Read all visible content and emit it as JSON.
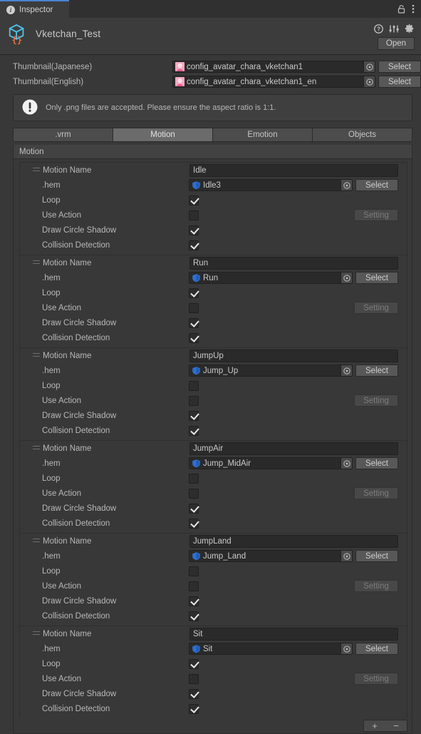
{
  "window": {
    "tab_label": "Inspector",
    "tab_icon": "info-icon",
    "lock_icon": "lock-icon",
    "menu_icon": "kebab-menu-icon"
  },
  "object_header": {
    "icon": "prefab-cube-braces-icon",
    "name": "Vketchan_Test",
    "help_icon": "help-icon",
    "preset_icon": "preset-sliders-icon",
    "settings_icon": "gear-icon",
    "open_label": "Open"
  },
  "thumbnails": [
    {
      "label": "Thumbnail(Japanese)",
      "value": "config_avatar_chara_vketchan1",
      "asset_icon": "texture-preview-icon",
      "picker_icon": "object-picker-icon",
      "select_label": "Select"
    },
    {
      "label": "Thumbnail(English)",
      "value": "config_avatar_chara_vketchan1_en",
      "asset_icon": "texture-preview-icon",
      "picker_icon": "object-picker-icon",
      "select_label": "Select"
    }
  ],
  "helpbox": {
    "icon": "warning-exclamation-icon",
    "text": "Only .png files are accepted. Please ensure the aspect ratio is 1:1."
  },
  "tabs": [
    {
      "label": ".vrm",
      "active": false
    },
    {
      "label": "Motion",
      "active": true
    },
    {
      "label": "Emotion",
      "active": false
    },
    {
      "label": "Objects",
      "active": false
    }
  ],
  "list": {
    "header": "Motion",
    "field_labels": {
      "motion_name": "Motion Name",
      "hem": ".hem",
      "loop": "Loop",
      "use_action": "Use Action",
      "draw_circle_shadow": "Draw Circle Shadow",
      "collision_detection": "Collision Detection"
    },
    "select_label": "Select",
    "setting_label": "Setting",
    "add_label": "+",
    "remove_label": "−",
    "items": [
      {
        "motion_name": "Idle",
        "hem": "Idle3",
        "loop": true,
        "use_action": false,
        "draw_circle_shadow": true,
        "collision_detection": true
      },
      {
        "motion_name": "Run",
        "hem": "Run",
        "loop": true,
        "use_action": false,
        "draw_circle_shadow": true,
        "collision_detection": true
      },
      {
        "motion_name": "JumpUp",
        "hem": "Jump_Up",
        "loop": false,
        "use_action": false,
        "draw_circle_shadow": true,
        "collision_detection": true
      },
      {
        "motion_name": "JumpAir",
        "hem": "Jump_MidAir",
        "loop": false,
        "use_action": false,
        "draw_circle_shadow": true,
        "collision_detection": true
      },
      {
        "motion_name": "JumpLand",
        "hem": "Jump_Land",
        "loop": false,
        "use_action": false,
        "draw_circle_shadow": true,
        "collision_detection": true
      },
      {
        "motion_name": "Sit",
        "hem": "Sit",
        "loop": true,
        "use_action": false,
        "draw_circle_shadow": true,
        "collision_detection": true
      }
    ]
  },
  "colors": {
    "panel_bg": "#383838",
    "header_bg": "#3c3c3c",
    "tab_accent": "#4a83d1",
    "field_bg": "#2a2a2a",
    "button_bg": "#585858",
    "tab_active": "#6b6b6b",
    "clip_icon": "#2f6fd0",
    "prefab_icon": "#4fc0e8",
    "brace_icon": "#f06a3c"
  }
}
